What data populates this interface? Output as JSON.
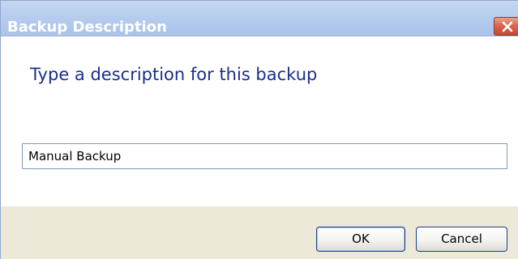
{
  "window": {
    "title": "Backup Description",
    "close_icon": "close-icon",
    "colors": {
      "titlebar": "#b6cdee",
      "title_text": "#ffffff",
      "close_button": "#d8694f",
      "instruction_text": "#1a2f8a",
      "footer": "#ece9d8"
    }
  },
  "content": {
    "instruction": "Type a description for this backup",
    "description_input": {
      "value": "Manual Backup",
      "placeholder": ""
    }
  },
  "buttons": {
    "ok_label": "OK",
    "cancel_label": "Cancel"
  }
}
